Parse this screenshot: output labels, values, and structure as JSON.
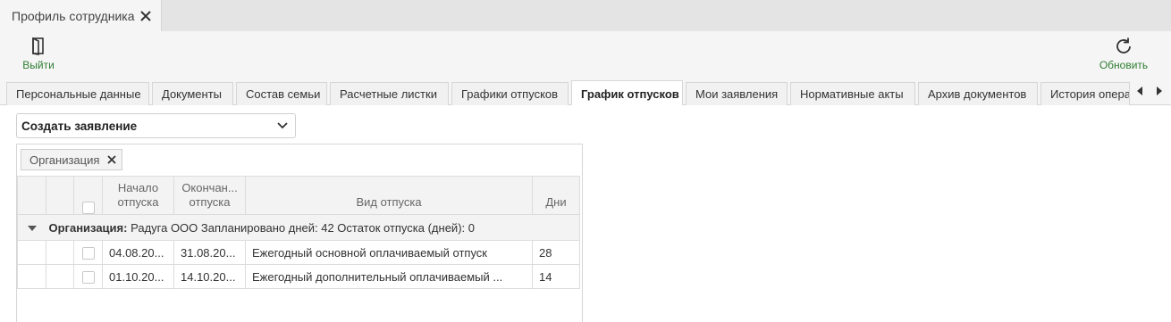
{
  "doc_tab": {
    "title": "Профиль сотрудника"
  },
  "toolbar": {
    "exit_label": "Выйти",
    "refresh_label": "Обновить"
  },
  "tabs": [
    "Персональные данные",
    "Документы",
    "Состав семьи",
    "Расчетные листки",
    "Графики отпусков",
    "График отпусков",
    "Мои заявления",
    "Нормативные акты",
    "Архив документов",
    "История операций"
  ],
  "active_tab": "График отпусков",
  "create_select": {
    "value": "Создать заявление"
  },
  "grouping": {
    "chip_label": "Организация"
  },
  "grid": {
    "columns": {
      "start_l1": "Начало",
      "start_l2": "отпуска",
      "end_l1": "Окончан...",
      "end_l2": "отпуска",
      "type": "Вид отпуска",
      "days": "Дни"
    },
    "group_row": {
      "field_label": "Организация:",
      "text": "Радуга ООО Запланировано дней: 42 Остаток отпуска (дней): 0"
    },
    "rows": [
      {
        "start": "04.08.20...",
        "end": "31.08.20...",
        "type": "Ежегодный основной оплачиваемый отпуск",
        "days": "28"
      },
      {
        "start": "01.10.20...",
        "end": "14.10.20...",
        "type": "Ежегодный дополнительный оплачиваемый ...",
        "days": "14"
      }
    ]
  },
  "colors": {
    "accent_green": "#2e7d32"
  },
  "icons": [
    "close-icon",
    "exit-door-icon",
    "refresh-icon",
    "chevron-down-icon",
    "arrow-left-icon",
    "arrow-right-icon",
    "collapse-triangle-icon"
  ]
}
